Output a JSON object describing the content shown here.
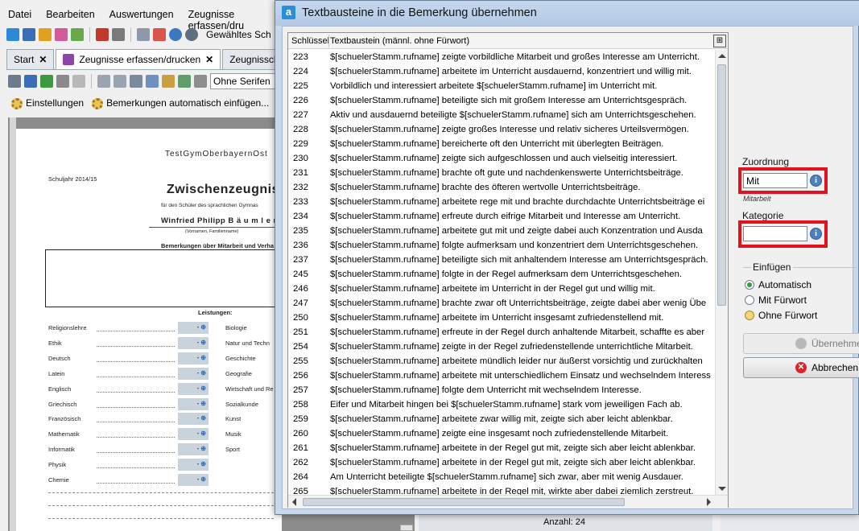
{
  "app": {
    "menu": [
      "Datei",
      "Bearbeiten",
      "Auswertungen",
      "Zeugnisse erfassen/dru"
    ],
    "toolbar_label": "Gewähltes Sch",
    "tabs": [
      {
        "label": "Start",
        "closable": true
      },
      {
        "label": "Zeugnisse erfassen/drucken",
        "closable": true
      },
      {
        "label": "Zeugnisschablon",
        "closable": false
      }
    ],
    "font_value": "Ohne Serifen",
    "actions": {
      "settings": "Einstellungen",
      "auto_insert": "Bemerkungen automatisch einfügen..."
    },
    "document": {
      "school": "TestGymOberbayernOst",
      "year": "Schuljahr 2014/15",
      "title": "Zwischenzeugnis",
      "subtitle": "für den Schüler des sprachlichen Gymnas",
      "student": "Winfried Philipp  B ä u m l e r",
      "name_hint": "(Vornamen, Familienname)",
      "remarks_heading": "Bemerkungen über Mitarbeit und Verha",
      "performance_heading": "Leistungen:",
      "subjects_left": [
        "Religionslehre",
        "Ethik",
        "Deutsch",
        "Latein",
        "Englisch",
        "Griechisch",
        "Französisch",
        "Mathematik",
        "Informatik",
        "Physik",
        "Chemie"
      ],
      "subjects_right": [
        "Biologie",
        "Natur und Techn",
        "Geschichte",
        "Geografie",
        "Wirtschaft und Re",
        "Sozialkunde",
        "Kunst",
        "Musik",
        "Sport"
      ],
      "grade_placeholder": "-"
    },
    "count_label": "Anzahl: 24"
  },
  "dialog": {
    "title": "Textbausteine in die Bemerkung übernehmen",
    "columns": {
      "key": "Schlüssel",
      "text": "Textbaustein (männl. ohne Fürwort)"
    },
    "rows": [
      {
        "key": "223",
        "text": "$[schuelerStamm.rufname] zeigte vorbildliche Mitarbeit und großes Interesse am Unterricht."
      },
      {
        "key": "224",
        "text": "$[schuelerStamm.rufname] arbeitete im Unterricht ausdauernd, konzentriert und willig mit."
      },
      {
        "key": "225",
        "text": "Vorbildlich und interessiert arbeitete $[schuelerStamm.rufname] im Unterricht mit."
      },
      {
        "key": "226",
        "text": "$[schuelerStamm.rufname] beteiligte sich mit großem Interesse am Unterrichtsgespräch."
      },
      {
        "key": "227",
        "text": "Aktiv und ausdauernd beteiligte $[schuelerStamm.rufname] sich am Unterrichtsgeschehen."
      },
      {
        "key": "228",
        "text": "$[schuelerStamm.rufname] zeigte großes Interesse und relativ sicheres Urteilsvermögen."
      },
      {
        "key": "229",
        "text": "$[schuelerStamm.rufname] bereicherte oft den Unterricht mit überlegten Beiträgen."
      },
      {
        "key": "230",
        "text": "$[schuelerStamm.rufname] zeigte sich aufgeschlossen und auch vielseitig interessiert."
      },
      {
        "key": "231",
        "text": "$[schuelerStamm.rufname] brachte oft gute und nachdenkenswerte Unterrichtsbeiträge."
      },
      {
        "key": "232",
        "text": "$[schuelerStamm.rufname] brachte des öfteren wertvolle Unterrichtsbeiträge."
      },
      {
        "key": "233",
        "text": "$[schuelerStamm.rufname] arbeitete rege mit und brachte durchdachte Unterrichtsbeiträge ei"
      },
      {
        "key": "234",
        "text": "$[schuelerStamm.rufname] erfreute durch eifrige Mitarbeit und Interesse am Unterricht."
      },
      {
        "key": "235",
        "text": "$[schuelerStamm.rufname] arbeitete gut mit und zeigte dabei auch Konzentration und Ausda"
      },
      {
        "key": "236",
        "text": "$[schuelerStamm.rufname] folgte aufmerksam und konzentriert dem Unterrichtsgeschehen."
      },
      {
        "key": "237",
        "text": "$[schuelerStamm.rufname] beteiligte sich mit anhaltendem Interesse am Unterrichtsgespräch."
      },
      {
        "key": "245",
        "text": "$[schuelerStamm.rufname] folgte in der Regel aufmerksam dem Unterrichtsgeschehen."
      },
      {
        "key": "246",
        "text": "$[schuelerStamm.rufname] arbeitete im Unterricht in der Regel gut und willig mit."
      },
      {
        "key": "247",
        "text": "$[schuelerStamm.rufname] brachte zwar oft Unterrichtsbeiträge, zeigte dabei aber wenig Übe"
      },
      {
        "key": "250",
        "text": "$[schuelerStamm.rufname] arbeitete im Unterricht insgesamt zufriedenstellend mit."
      },
      {
        "key": "251",
        "text": "$[schuelerStamm.rufname] erfreute in der Regel durch anhaltende Mitarbeit, schaffte es aber"
      },
      {
        "key": "254",
        "text": "$[schuelerStamm.rufname] zeigte in der Regel zufriedenstellende unterrichtliche Mitarbeit."
      },
      {
        "key": "255",
        "text": "$[schuelerStamm.rufname] arbeitete mündlich leider nur äußerst vorsichtig und zurückhalten"
      },
      {
        "key": "256",
        "text": "$[schuelerStamm.rufname] arbeitete mit unterschiedlichem Einsatz und wechselndem Interess"
      },
      {
        "key": "257",
        "text": "$[schuelerStamm.rufname] folgte dem Unterricht mit wechselndem Interesse."
      },
      {
        "key": "258",
        "text": "Eifer und Mitarbeit hingen bei $[schuelerStamm.rufname] stark vom jeweiligen Fach ab."
      },
      {
        "key": "259",
        "text": "$[schuelerStamm.rufname] arbeitete zwar willig mit, zeigte sich aber leicht ablenkbar."
      },
      {
        "key": "260",
        "text": "$[schuelerStamm.rufname] zeigte eine insgesamt noch zufriedenstellende Mitarbeit."
      },
      {
        "key": "261",
        "text": "$[schuelerStamm.rufname] arbeitete in der Regel gut mit, zeigte sich aber leicht ablenkbar."
      },
      {
        "key": "262",
        "text": "$[schuelerStamm.rufname] arbeitete in der Regel gut mit, zeigte sich aber leicht ablenkbar."
      },
      {
        "key": "264",
        "text": "Am Unterricht beteiligte $[schuelerStamm.rufname] sich zwar, aber mit wenig Ausdauer."
      },
      {
        "key": "265",
        "text": "$[schuelerStamm.rufname] arbeitete in der Regel mit, wirkte aber dabei ziemlich zerstreut."
      }
    ],
    "zuordnung": {
      "label": "Zuordnung",
      "value": "Mit",
      "hint": "Mitarbeit"
    },
    "kategorie": {
      "label": "Kategorie",
      "value": ""
    },
    "einfuegen": {
      "label": "Einfügen",
      "options": [
        {
          "label": "Automatisch",
          "selected": true
        },
        {
          "label": "Mit Fürwort",
          "selected": false
        },
        {
          "label": "Ohne Fürwort",
          "selected": false
        }
      ]
    },
    "buttons": {
      "accept": "Übernehmen",
      "cancel": "Abbrechen"
    },
    "highlight_color": "#e0141e"
  }
}
